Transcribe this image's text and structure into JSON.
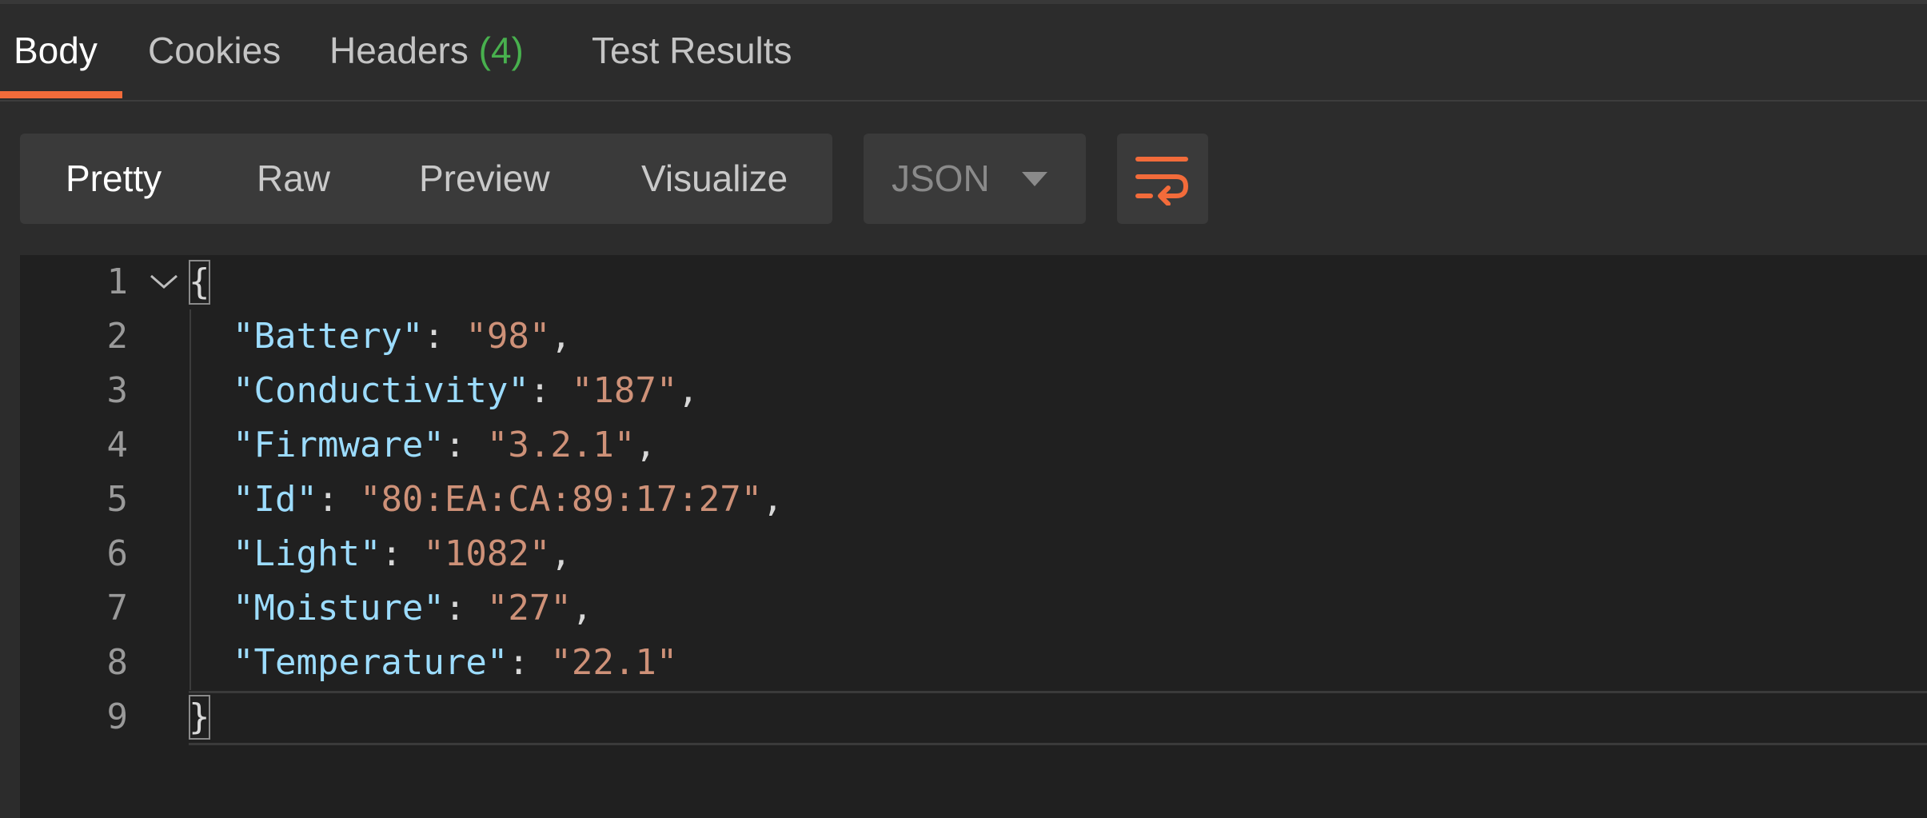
{
  "response_tabs": [
    {
      "label": "Body"
    },
    {
      "label": "Cookies"
    },
    {
      "label": "Headers",
      "count": "(4)"
    },
    {
      "label": "Test Results"
    }
  ],
  "active_tab": "Body",
  "view_modes": [
    "Pretty",
    "Raw",
    "Preview",
    "Visualize"
  ],
  "active_view_mode": "Pretty",
  "format_select": {
    "value": "JSON"
  },
  "wrap_button": {
    "icon": "wrap-lines-icon"
  },
  "colors": {
    "accent": "#f26b3a",
    "count": "#48b04e",
    "json_key": "#9cdcfe",
    "json_string": "#ce9178"
  },
  "editor": {
    "line_numbers": [
      "1",
      "2",
      "3",
      "4",
      "5",
      "6",
      "7",
      "8",
      "9"
    ],
    "open_brace": "{",
    "close_brace": "}",
    "entries": [
      {
        "key": "\"Battery\"",
        "value": "\"98\"",
        "sep": ","
      },
      {
        "key": "\"Conductivity\"",
        "value": "\"187\"",
        "sep": ","
      },
      {
        "key": "\"Firmware\"",
        "value": "\"3.2.1\"",
        "sep": ","
      },
      {
        "key": "\"Id\"",
        "value": "\"80:EA:CA:89:17:27\"",
        "sep": ","
      },
      {
        "key": "\"Light\"",
        "value": "\"1082\"",
        "sep": ","
      },
      {
        "key": "\"Moisture\"",
        "value": "\"27\"",
        "sep": ","
      },
      {
        "key": "\"Temperature\"",
        "value": "\"22.1\"",
        "sep": ""
      }
    ]
  }
}
